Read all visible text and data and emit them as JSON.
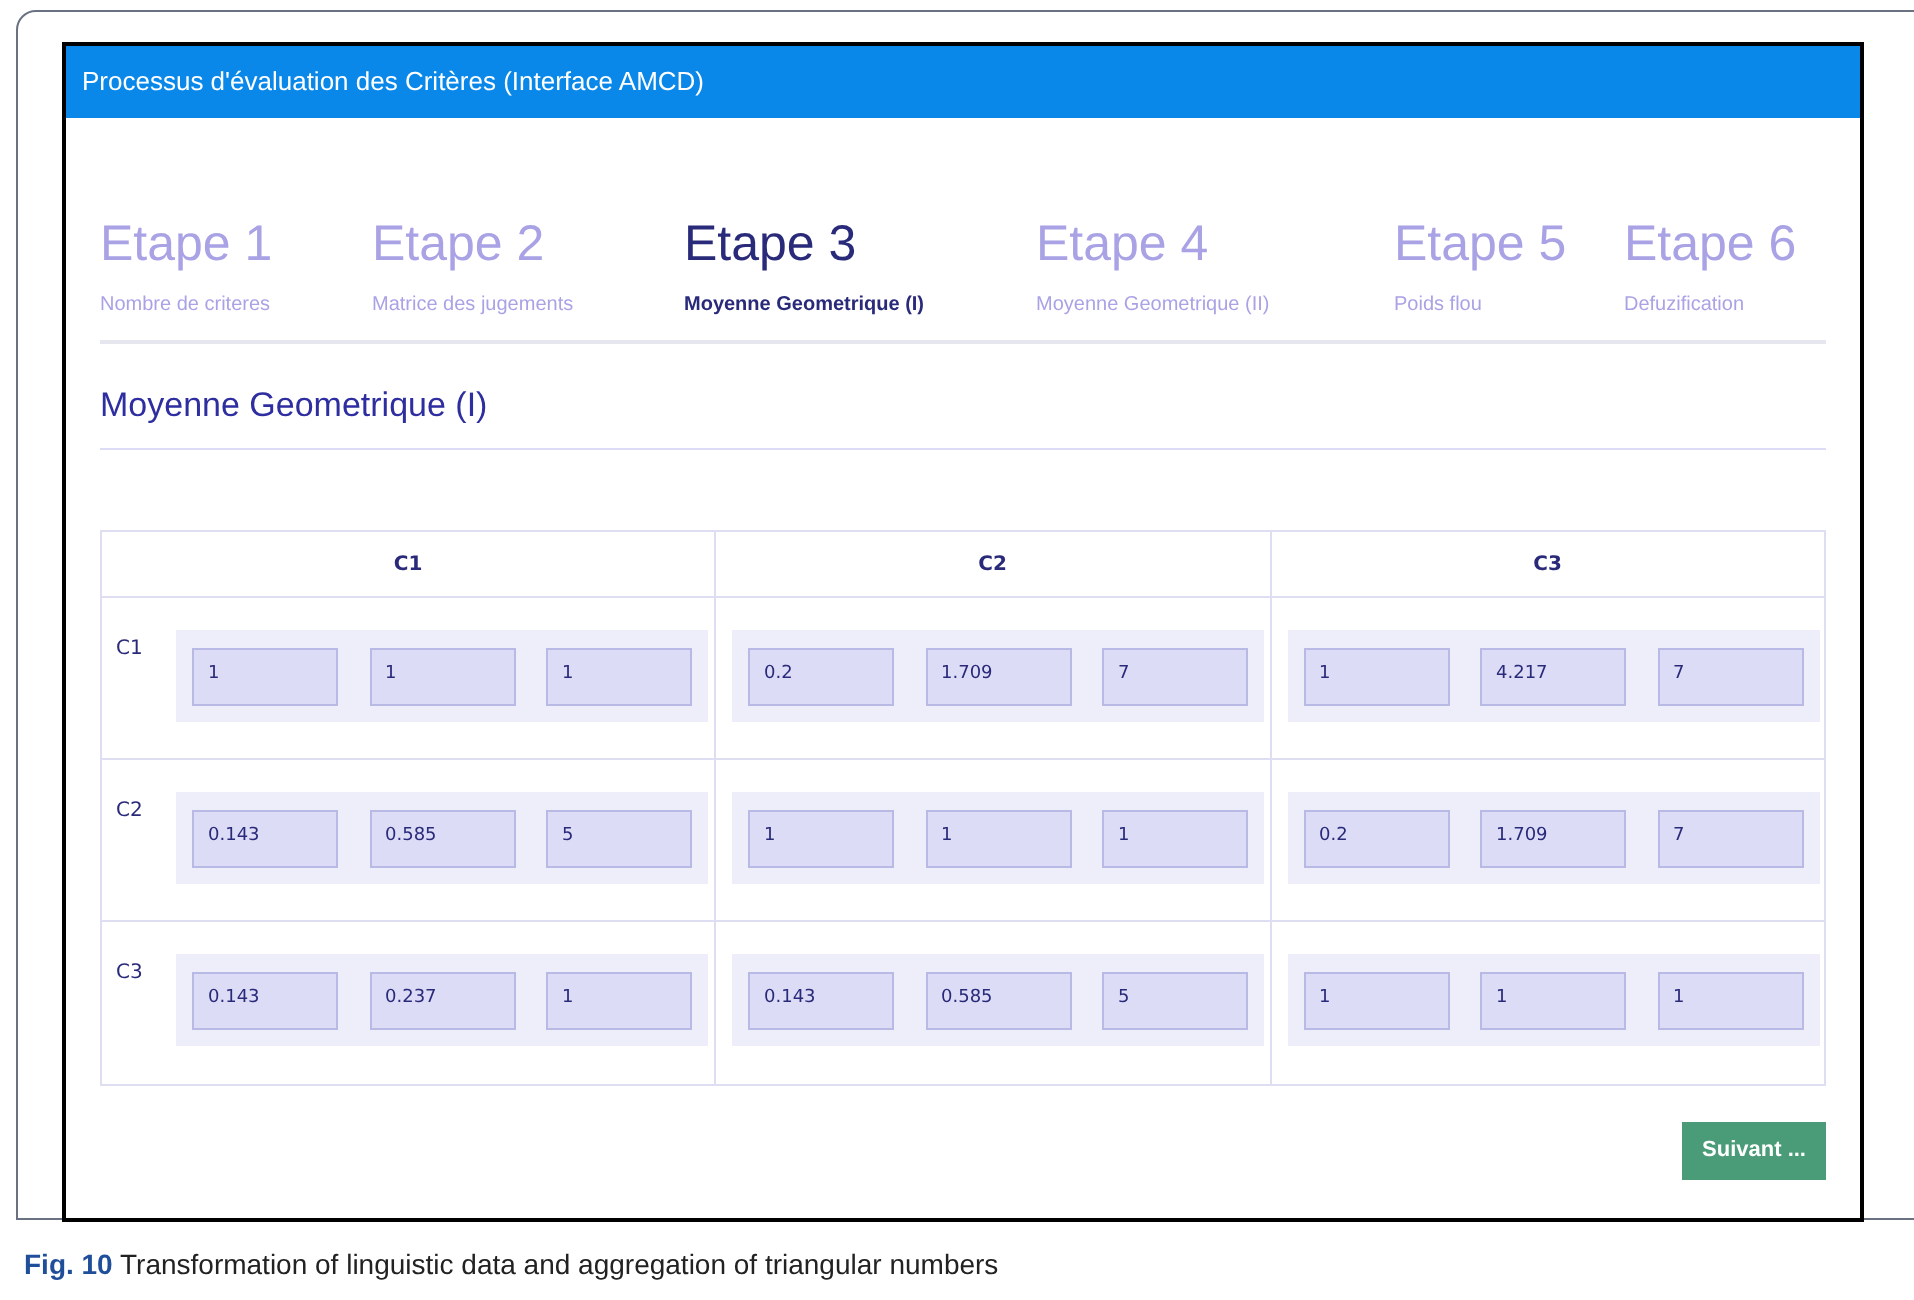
{
  "window": {
    "title": "Processus d'évaluation des Critères (Interface AMCD)"
  },
  "steps": [
    {
      "label": "Etape 1",
      "caption": "Nombre de criteres",
      "selected": false
    },
    {
      "label": "Etape 2",
      "caption": "Matrice des jugements",
      "selected": false
    },
    {
      "label": "Etape 3",
      "caption": "Moyenne Geometrique (I)",
      "selected": true
    },
    {
      "label": "Etape 4",
      "caption": "Moyenne Geometrique (II)",
      "selected": false
    },
    {
      "label": "Etape 5",
      "caption": "Poids flou",
      "selected": false
    },
    {
      "label": "Etape 6",
      "caption": "Defuzification",
      "selected": false
    }
  ],
  "section_title": "Moyenne Geometrique (I)",
  "matrix": {
    "columns": [
      "C1",
      "C2",
      "C3"
    ],
    "rows": [
      {
        "label": "C1",
        "cells": [
          [
            "1",
            "1",
            "1"
          ],
          [
            "0.2",
            "1.709",
            "7"
          ],
          [
            "1",
            "4.217",
            "7"
          ]
        ]
      },
      {
        "label": "C2",
        "cells": [
          [
            "0.143",
            "0.585",
            "5"
          ],
          [
            "1",
            "1",
            "1"
          ],
          [
            "0.2",
            "1.709",
            "7"
          ]
        ]
      },
      {
        "label": "C3",
        "cells": [
          [
            "0.143",
            "0.237",
            "1"
          ],
          [
            "0.143",
            "0.585",
            "5"
          ],
          [
            "1",
            "1",
            "1"
          ]
        ]
      }
    ]
  },
  "next_button": "Suivant ...",
  "caption": {
    "label": "Fig. 10",
    "text": "Transformation of linguistic data and aggregation of triangular numbers"
  }
}
